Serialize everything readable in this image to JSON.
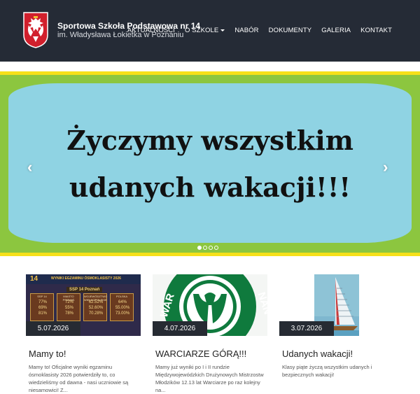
{
  "header": {
    "school_name": "Sportowa Szkoła Podstawowa nr 14",
    "school_subtitle": "im. Władysława Łokietka w Poznaniu",
    "logo_icon": "white-eagle-coat-of-arms-icon",
    "nav": [
      {
        "label": "AKTUALNOŚCI",
        "has_dropdown": false
      },
      {
        "label": "O SZKOLE",
        "has_dropdown": true
      },
      {
        "label": "NABÓR",
        "has_dropdown": false
      },
      {
        "label": "DOKUMENTY",
        "has_dropdown": false
      },
      {
        "label": "GALERIA",
        "has_dropdown": false
      },
      {
        "label": "KONTAKT",
        "has_dropdown": false
      }
    ]
  },
  "slider": {
    "line1": "Życzymy wszystkim",
    "line2": "udanych wakacji!!!",
    "prev_symbol": "‹",
    "next_symbol": "›",
    "dot_count": 4,
    "active_dot": 1,
    "colors": {
      "yellow": "#f6e019",
      "green": "#8cc63f",
      "panel": "#8fd3e3"
    }
  },
  "posts": [
    {
      "date": "5.07.2026",
      "title": "Mamy to!",
      "excerpt": "Mamy to! Oficjalne wyniki egzaminu ósmoklasisty 2026 potwierdziły to, co wiedzieliśmy od dawna - nasi uczniowie są niesamowici! Z...",
      "image": {
        "badge": "14",
        "heading": "WYNIKI EGZAMINU ÓSMOKLASISTY 2026",
        "school": "SSP 14 Poznań",
        "cards": [
          {
            "caption": "SSP 14",
            "values": [
              "77%",
              "69%",
              "81%"
            ]
          },
          {
            "caption": "MIASTO POZNAŃ",
            "values": [
              "72%",
              "55%",
              "78%"
            ]
          },
          {
            "caption": "WOJEWÓDZTWO WIELKOPOLSKIE",
            "values": [
              "62.52%",
              "52.60%",
              "70.28%"
            ]
          },
          {
            "caption": "POLSKA",
            "values": [
              "64%",
              "55.00%",
              "73.00%"
            ]
          }
        ]
      }
    },
    {
      "date": "4.07.2026",
      "title": "WARCIARZE GÓRĄ!!!",
      "excerpt": "Mamy już wyniki po I i II rundzie Międzywojewódzkich Drużynowych Mistrzostw Młodzików 12.13 lat Warciarze po raz kolejny na...",
      "image": {
        "ring_text_left": "WAR",
        "ring_text_right": "NAŃ"
      }
    },
    {
      "date": "3.07.2026",
      "title": "Udanych wakacji!",
      "excerpt": "Klasy piąte życzą wszystkim udanych i bezpiecznych wakacji!",
      "image": {
        "icon": "sailboat-icon"
      }
    }
  ]
}
